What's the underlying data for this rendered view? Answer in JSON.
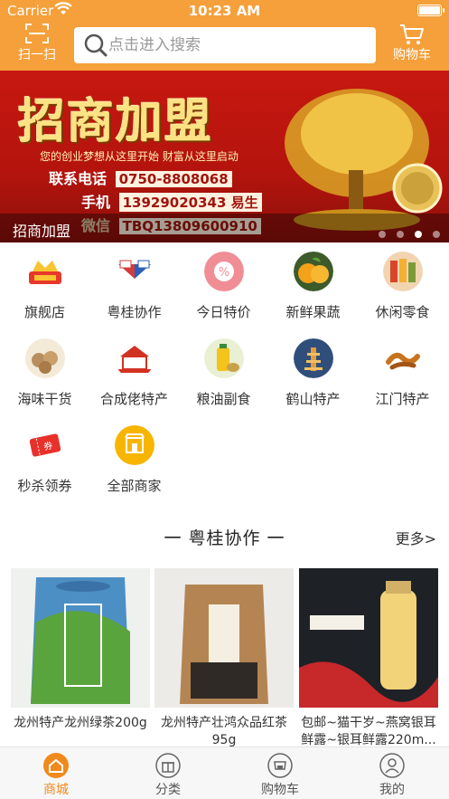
{
  "status_bar": {
    "carrier": "Carrier",
    "time": "10:23 AM"
  },
  "header": {
    "scan_label": "扫一扫",
    "search_placeholder": "点击进入搜索",
    "cart_label": "购物车",
    "accent_color": "#f5a03a"
  },
  "banner": {
    "headline": "招商加盟",
    "tagline": "您的创业梦想从这里开始    财富从这里启动",
    "phone_label": "联系电话",
    "phone": "0750-8808068",
    "mobile_label": "手机",
    "mobile": "13929020343 易生",
    "wechat_label": "微信",
    "wechat": "TBQ13809600910",
    "caption": "招商加盟",
    "slide_count": 4,
    "active_slide": 3
  },
  "categories": [
    {
      "label": "旗舰店",
      "icon": "flagship-store-icon"
    },
    {
      "label": "粤桂协作",
      "icon": "guangdong-guangxi-cooperation-icon"
    },
    {
      "label": "今日特价",
      "icon": "percent-discount-icon"
    },
    {
      "label": "新鲜果蔬",
      "icon": "fresh-fruit-icon"
    },
    {
      "label": "休闲零食",
      "icon": "snacks-icon"
    },
    {
      "label": "海味干货",
      "icon": "dried-seafood-icon"
    },
    {
      "label": "合成佬特产",
      "icon": "hechenglao-specialty-icon"
    },
    {
      "label": "粮油副食",
      "icon": "grain-oil-icon"
    },
    {
      "label": "鹤山特产",
      "icon": "heshan-pagoda-icon"
    },
    {
      "label": "江门特产",
      "icon": "jiangmen-specialty-icon"
    },
    {
      "label": "秒杀领券",
      "icon": "coupon-ticket-icon"
    },
    {
      "label": "全部商家",
      "icon": "all-merchants-icon"
    }
  ],
  "section": {
    "title": "一  粤桂协作  一",
    "more": "更多>"
  },
  "products": [
    {
      "name": "龙州特产龙州绿茶200g"
    },
    {
      "name": "龙州特产壮鸿众品红茶 95g"
    },
    {
      "name": "包邮~猫干岁~燕窝银耳鲜露~银耳鲜露220m..."
    }
  ],
  "tabbar": [
    {
      "label": "商城",
      "icon": "home-icon",
      "active": true
    },
    {
      "label": "分类",
      "icon": "gift-category-icon",
      "active": false
    },
    {
      "label": "购物车",
      "icon": "shop-cart-icon",
      "active": false
    },
    {
      "label": "我的",
      "icon": "user-profile-icon",
      "active": false
    }
  ]
}
